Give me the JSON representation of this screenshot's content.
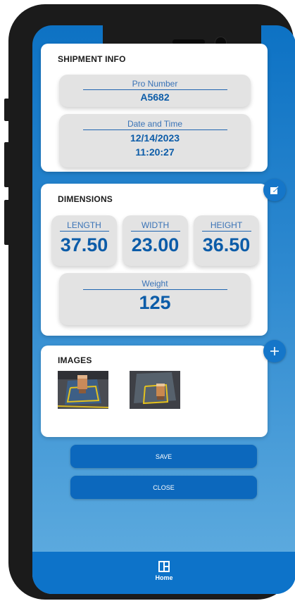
{
  "shipment": {
    "title": "SHIPMENT INFO",
    "pro_label": "Pro Number",
    "pro_value": "A5682",
    "datetime_label": "Date and Time",
    "date_value": "12/14/2023",
    "time_value": "11:20:27"
  },
  "dimensions": {
    "title": "DIMENSIONS",
    "length_label": "LENGTH",
    "length_value": "37.50",
    "width_label": "WIDTH",
    "width_value": "23.00",
    "height_label": "HEIGHT",
    "height_value": "36.50",
    "weight_label": "Weight",
    "weight_value": "125",
    "edit_icon": "edit-icon"
  },
  "images": {
    "title": "IMAGES",
    "add_icon": "plus-icon",
    "count": 2
  },
  "actions": {
    "save_label": "SAVE",
    "close_label": "CLOSE"
  },
  "nav": {
    "home_label": "Home",
    "home_icon": "dashboard-icon"
  },
  "colors": {
    "accent": "#0c68bd",
    "value_text": "#0c5ca8",
    "background_top": "#0d72c4",
    "background_bottom": "#62aee0"
  }
}
